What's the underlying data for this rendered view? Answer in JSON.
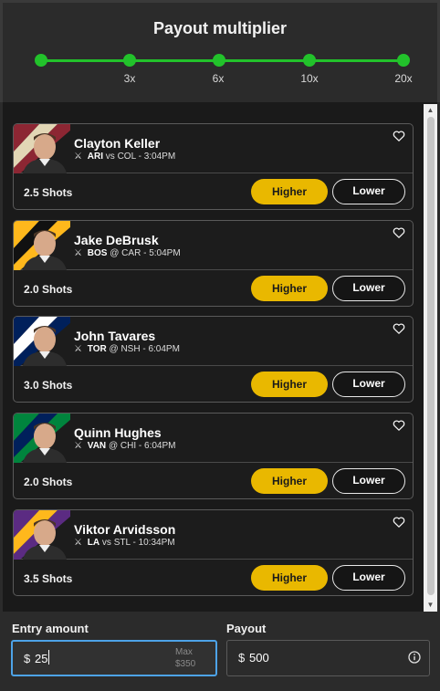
{
  "header": {
    "title": "Payout multiplier",
    "ticks": [
      "3x",
      "6x",
      "10x",
      "20x"
    ]
  },
  "colors": {
    "accent_green": "#22c22b",
    "higher_button": "#e9b800",
    "entry_focus": "#4da3e8"
  },
  "players": [
    {
      "name": "Clayton Keller",
      "team": "ARI",
      "sep": "vs",
      "opp": "COL",
      "time": "3:04PM",
      "stat": "2.5 Shots",
      "higher": "Higher",
      "lower": "Lower",
      "stripe": [
        "#8c2633",
        "#e2d6b5"
      ]
    },
    {
      "name": "Jake DeBrusk",
      "team": "BOS",
      "sep": "@",
      "opp": "CAR",
      "time": "5:04PM",
      "stat": "2.0 Shots",
      "higher": "Higher",
      "lower": "Lower",
      "stripe": [
        "#ffb81c",
        "#111111"
      ]
    },
    {
      "name": "John Tavares",
      "team": "TOR",
      "sep": "@",
      "opp": "NSH",
      "time": "6:04PM",
      "stat": "3.0 Shots",
      "higher": "Higher",
      "lower": "Lower",
      "stripe": [
        "#00205b",
        "#ffffff"
      ]
    },
    {
      "name": "Quinn Hughes",
      "team": "VAN",
      "sep": "@",
      "opp": "CHI",
      "time": "6:04PM",
      "stat": "2.0 Shots",
      "higher": "Higher",
      "lower": "Lower",
      "stripe": [
        "#00843d",
        "#00205b"
      ]
    },
    {
      "name": "Viktor Arvidsson",
      "team": "LA",
      "sep": "vs",
      "opp": "STL",
      "time": "10:34PM",
      "stat": "3.5 Shots",
      "higher": "Higher",
      "lower": "Lower",
      "stripe": [
        "#5b2b82",
        "#ffb81c"
      ]
    }
  ],
  "footer": {
    "entry_label": "Entry amount",
    "entry_currency": "$",
    "entry_value": "25",
    "entry_max_label": "Max",
    "entry_max_value": "$350",
    "payout_label": "Payout",
    "payout_currency": "$",
    "payout_value": "500"
  }
}
